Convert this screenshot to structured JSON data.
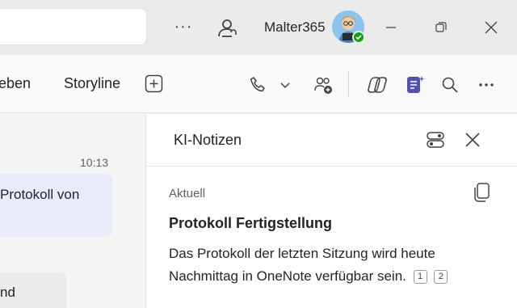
{
  "titlebar": {
    "username": "Malter365",
    "more_label": "···"
  },
  "tabs": [
    {
      "label": "geben"
    },
    {
      "label": "Storyline"
    }
  ],
  "chat": {
    "timestamp": "10:13",
    "message1": "Protokoll von",
    "message2": "nd"
  },
  "panel": {
    "title": "KI-Notizen",
    "section": "Aktuell",
    "note_title": "Protokoll Fertigstellung",
    "note_body": "Das Protokoll der letzten Sitzung wird heute Nachmittag in OneNote verfügbar sein.",
    "refs": [
      "1",
      "2"
    ]
  }
}
